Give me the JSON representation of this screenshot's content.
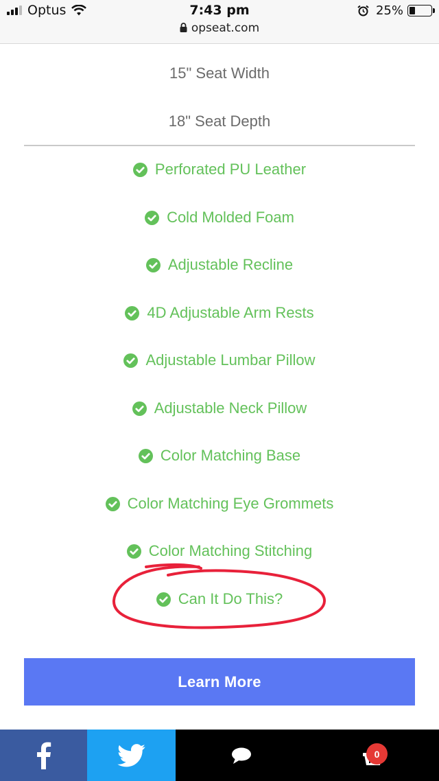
{
  "status_bar": {
    "carrier": "Optus",
    "time": "7:43 pm",
    "url": "opseat.com",
    "battery": "25%",
    "battery_level": 0.25
  },
  "specs": [
    "15\" Seat Width",
    "18\" Seat Depth"
  ],
  "features": [
    "Perforated PU Leather",
    "Cold Molded Foam",
    "Adjustable Recline",
    "4D Adjustable Arm Rests",
    "Adjustable Lumbar Pillow",
    "Adjustable Neck Pillow",
    "Color Matching Base",
    "Color Matching Eye Grommets",
    "Color Matching Stitching",
    "Can It Do This?"
  ],
  "cta": {
    "label": "Learn More"
  },
  "share_bar": {
    "cart_count": "0"
  },
  "colors": {
    "feature_green": "#63c15a",
    "button_blue": "#5a78f3",
    "facebook": "#3a5ba0",
    "twitter": "#1da1f2",
    "annotation_red": "#e8213a"
  }
}
